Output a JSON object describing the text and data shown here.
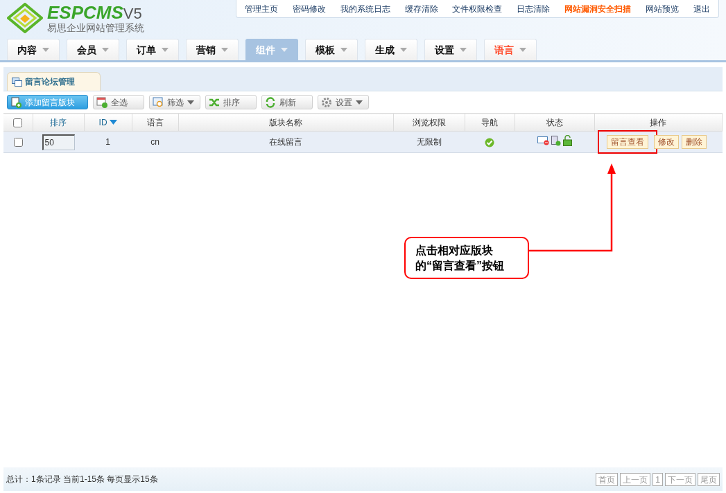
{
  "logo": {
    "brand": "ESPCMS",
    "version": "V5",
    "subtitle": "易思企业网站管理系统"
  },
  "top_links": [
    {
      "label": "管理主页",
      "highlighted": false
    },
    {
      "label": "密码修改",
      "highlighted": false
    },
    {
      "label": "我的系统日志",
      "highlighted": false
    },
    {
      "label": "缓存清除",
      "highlighted": false
    },
    {
      "label": "文件权限检查",
      "highlighted": false
    },
    {
      "label": "日志清除",
      "highlighted": false
    },
    {
      "label": "网站漏洞安全扫描",
      "highlighted": true
    },
    {
      "label": "网站预览",
      "highlighted": false
    },
    {
      "label": "退出",
      "highlighted": false
    }
  ],
  "nav_tabs": [
    {
      "label": "内容",
      "selected": false,
      "highlighted": false
    },
    {
      "label": "会员",
      "selected": false,
      "highlighted": false
    },
    {
      "label": "订单",
      "selected": false,
      "highlighted": false
    },
    {
      "label": "营销",
      "selected": false,
      "highlighted": false
    },
    {
      "label": "组件",
      "selected": true,
      "highlighted": false
    },
    {
      "label": "模板",
      "selected": false,
      "highlighted": false
    },
    {
      "label": "生成",
      "selected": false,
      "highlighted": false
    },
    {
      "label": "设置",
      "selected": false,
      "highlighted": false
    },
    {
      "label": "语言",
      "selected": false,
      "highlighted": true
    }
  ],
  "panel_tab": "留言论坛管理",
  "toolbar": [
    {
      "label": "添加留言版块",
      "kind": "primary",
      "dropdown": false
    },
    {
      "label": "全选",
      "kind": "normal",
      "dropdown": false
    },
    {
      "label": "筛选",
      "kind": "normal",
      "dropdown": true
    },
    {
      "label": "排序",
      "kind": "normal",
      "dropdown": false
    },
    {
      "label": "刷新",
      "kind": "normal",
      "dropdown": false
    },
    {
      "label": "设置",
      "kind": "normal",
      "dropdown": true
    }
  ],
  "table": {
    "select_all": {
      "checked": false
    },
    "columns": [
      {
        "label": "排序",
        "sortable": true,
        "sorted": false
      },
      {
        "label": "ID",
        "sortable": true,
        "sorted": true
      },
      {
        "label": "语言",
        "sortable": false,
        "sorted": false
      },
      {
        "label": "版块名称",
        "sortable": false,
        "sorted": false
      },
      {
        "label": "浏览权限",
        "sortable": false,
        "sorted": false
      },
      {
        "label": "导航",
        "sortable": false,
        "sorted": false
      },
      {
        "label": "状态",
        "sortable": false,
        "sorted": false
      },
      {
        "label": "操作",
        "sortable": false,
        "sorted": false
      }
    ],
    "rows": [
      {
        "checked": false,
        "order": "50",
        "id": "1",
        "language": "cn",
        "name": "在线留言",
        "permission": "无限制",
        "nav": true,
        "actions": [
          {
            "label": "留言查看",
            "highlighted": true
          },
          {
            "label": "修改",
            "highlighted": false
          },
          {
            "label": "删除",
            "highlighted": false
          }
        ]
      }
    ]
  },
  "annotation": {
    "text": "点击相对应版块的“留言查看”按钮"
  },
  "footer": {
    "summary": "总计：1条记录 当前1-15条 每页显示15条",
    "pages": [
      "首页",
      "上一页",
      "1",
      "下一页",
      "尾页"
    ]
  }
}
